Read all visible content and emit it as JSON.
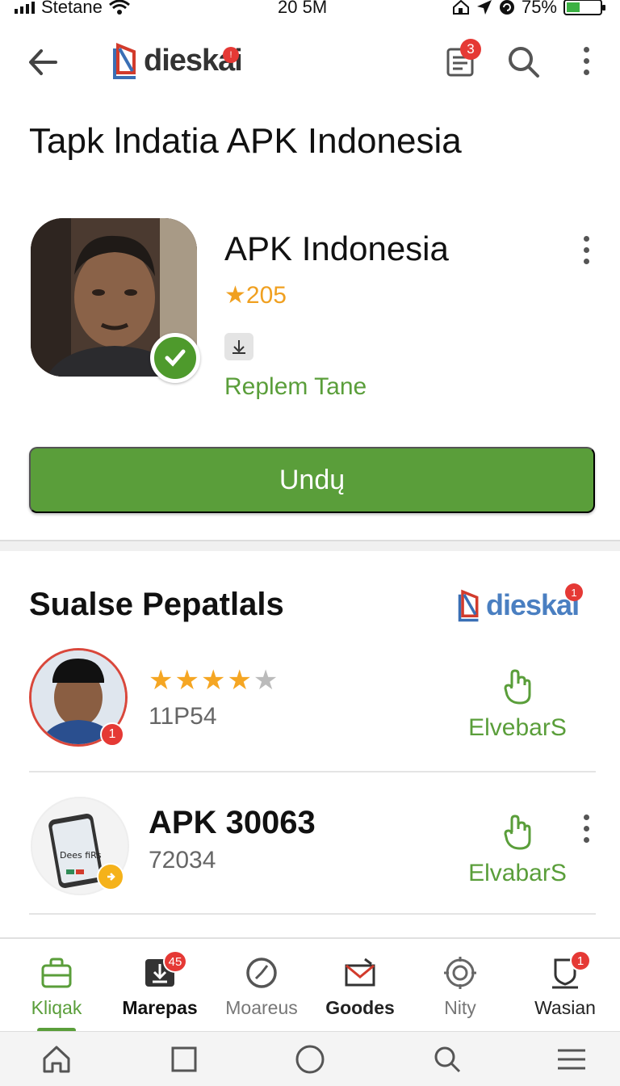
{
  "status_bar": {
    "carrier": "Stetane",
    "time": "20 5M",
    "battery": "75%"
  },
  "appbar": {
    "brand": "dieskai",
    "notification_count": "3"
  },
  "page_title": "Tapk lndatia APK Indonesia",
  "app": {
    "name": "APK Indonesia",
    "rating": "★205",
    "developer": "Replem Tane",
    "install_label": "Undų"
  },
  "section": {
    "title": "Sualse Pepatlals",
    "brand": "dieskai",
    "brand_badge": "1",
    "items": [
      {
        "stars_on": "★★★★",
        "stars_off": "★",
        "meta": "11P54",
        "action_label": "ElvebarS",
        "avatar_badge": "1"
      },
      {
        "title": "APK 30063",
        "meta": "72034",
        "action_label": "ElvabarS",
        "avatar_caption": "Dees fiRs"
      }
    ]
  },
  "bottom_nav": [
    {
      "label": "Kliqak",
      "active": true
    },
    {
      "label": "Marepas",
      "badge": "45"
    },
    {
      "label": "Moareus"
    },
    {
      "label": "Goodes"
    },
    {
      "label": "Nity"
    },
    {
      "label": "Wasian",
      "badge": "1"
    }
  ],
  "colors": {
    "accent": "#5a9e3a",
    "star": "#f5a623",
    "badge": "#e53935",
    "brand_blue": "#4a7fc1"
  }
}
